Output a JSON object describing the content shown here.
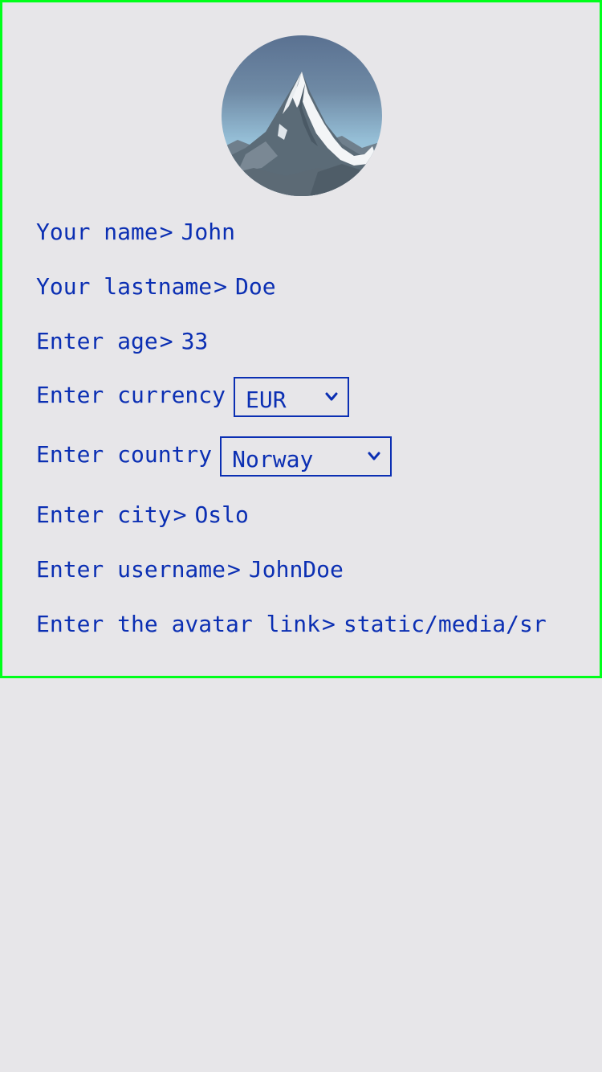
{
  "avatar": {
    "alt": "mountain avatar"
  },
  "form": {
    "name": {
      "label": "Your name",
      "prompt": ">",
      "value": "John"
    },
    "lastname": {
      "label": "Your lastname",
      "prompt": ">",
      "value": "Doe"
    },
    "age": {
      "label": "Enter age",
      "prompt": ">",
      "value": "33"
    },
    "currency": {
      "label": "Enter currency",
      "selected": "EUR"
    },
    "country": {
      "label": "Enter country",
      "selected": "Norway"
    },
    "city": {
      "label": "Enter city",
      "prompt": ">",
      "value": "Oslo"
    },
    "username": {
      "label": "Enter username",
      "prompt": ">",
      "value": "JohnDoe"
    },
    "avatar_link": {
      "label": "Enter the avatar link",
      "prompt": ">",
      "value": "static/media/sr"
    }
  },
  "colors": {
    "text": "#0b2fb3",
    "frame_border": "#00ff1a",
    "background": "#e7e6e9"
  },
  "icons": {
    "dropdown": "chevron-down-icon"
  }
}
